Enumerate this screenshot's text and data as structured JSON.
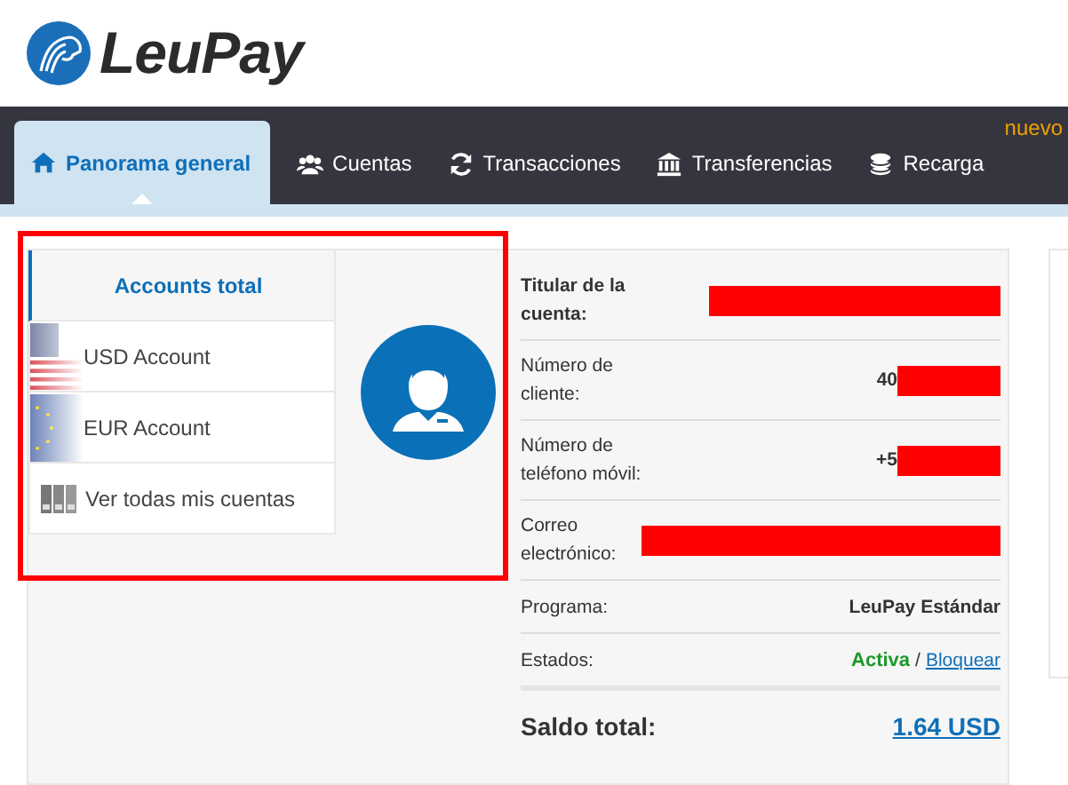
{
  "brand": {
    "name": "LeuPay"
  },
  "nav": {
    "badge": "nuevo",
    "tabs": [
      {
        "label": "Panorama general",
        "selected": true
      },
      {
        "label": "Cuentas",
        "selected": false
      },
      {
        "label": "Transacciones",
        "selected": false
      },
      {
        "label": "Transferencias",
        "selected": false
      },
      {
        "label": "Recarga",
        "selected": false
      }
    ]
  },
  "accounts": {
    "highlighted": true,
    "items": [
      {
        "label": "Accounts total",
        "kind": "total",
        "selected": true
      },
      {
        "label": "USD Account",
        "kind": "usd",
        "selected": false
      },
      {
        "label": "EUR Account",
        "kind": "eur",
        "selected": false
      },
      {
        "label": "Ver todas mis cuentas",
        "kind": "all",
        "selected": false
      }
    ]
  },
  "profile": {
    "rows": [
      {
        "label": "Titular de la cuenta:",
        "redacted": true
      },
      {
        "label": "Número de cliente:",
        "value": "40",
        "redacted": true
      },
      {
        "label": "Número de teléfono móvil:",
        "value": "+5",
        "redacted": true
      },
      {
        "label": "Correo electrónico:",
        "redacted": true
      },
      {
        "label": "Programa:",
        "value": "LeuPay Estándar"
      },
      {
        "label": "Estados:",
        "status": "Activa",
        "separator": "/",
        "link": "Bloquear"
      }
    ],
    "total_label": "Saldo total:",
    "total_value": "1.64 USD"
  }
}
